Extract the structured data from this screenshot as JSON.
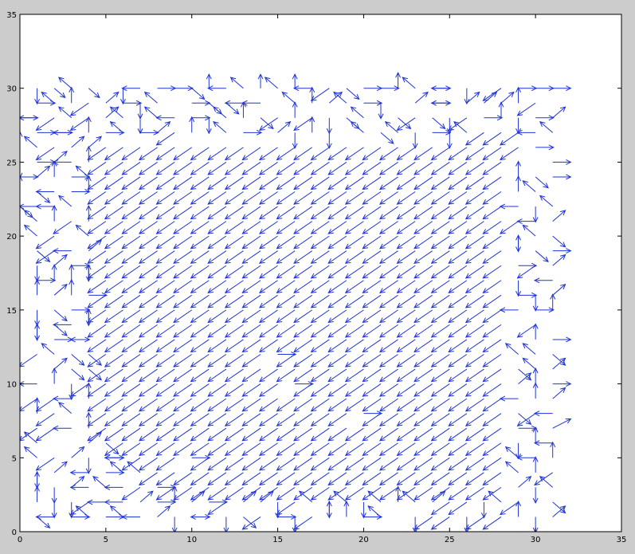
{
  "chart_data": {
    "type": "quiver",
    "title": "",
    "xlabel": "",
    "ylabel": "",
    "xlim": [
      0,
      35
    ],
    "ylim": [
      0,
      35
    ],
    "xticks": [
      0,
      5,
      10,
      15,
      20,
      25,
      30,
      35
    ],
    "yticks": [
      0,
      5,
      10,
      15,
      20,
      25,
      30,
      35
    ],
    "grid": false,
    "arrow_color": "#1f33d6",
    "axes_background": "#ffffff",
    "figure_background": "#cccccc",
    "field": {
      "x_range": [
        0,
        31
      ],
      "y_range": [
        1,
        30
      ],
      "grid_step": 1,
      "dominant_direction": "down-left (diagonal)",
      "dominant_vector": [
        -1,
        -0.8
      ]
    },
    "vectors_sample": [
      {
        "x": 1,
        "y": 28,
        "u": -1,
        "v": 0
      },
      {
        "x": 2,
        "y": 30,
        "u": 0.6,
        "v": -0.6
      },
      {
        "x": 4,
        "y": 30,
        "u": 0.6,
        "v": -0.6
      },
      {
        "x": 8,
        "y": 30,
        "u": 1,
        "v": 0
      },
      {
        "x": 9,
        "y": 30,
        "u": 1,
        "v": 0
      },
      {
        "x": 11,
        "y": 30,
        "u": 0,
        "v": 0.9
      },
      {
        "x": 14,
        "y": 30,
        "u": 0,
        "v": 0.9
      },
      {
        "x": 16,
        "y": 30,
        "u": 0,
        "v": 0.9
      },
      {
        "x": 20,
        "y": 30,
        "u": 1,
        "v": 0
      },
      {
        "x": 21,
        "y": 30,
        "u": 1,
        "v": 0
      },
      {
        "x": 29,
        "y": 30,
        "u": 1,
        "v": 0
      },
      {
        "x": 31,
        "y": 30,
        "u": 1,
        "v": 0
      },
      {
        "x": 31,
        "y": 25,
        "u": 1,
        "v": 0
      },
      {
        "x": 31,
        "y": 19,
        "u": 1,
        "v": 0
      },
      {
        "x": 31,
        "y": 13,
        "u": 1,
        "v": 0
      },
      {
        "x": 31,
        "y": 7,
        "u": 1,
        "v": 0.6
      },
      {
        "x": 30,
        "y": 1,
        "u": 0,
        "v": -1
      },
      {
        "x": 30,
        "y": 3,
        "u": 0,
        "v": -1
      },
      {
        "x": 3,
        "y": 1,
        "u": 1,
        "v": 0
      },
      {
        "x": 10,
        "y": 1,
        "u": 1,
        "v": 0
      },
      {
        "x": 15,
        "y": 1,
        "u": 1,
        "v": 0
      },
      {
        "x": 20,
        "y": 1,
        "u": 1,
        "v": 0
      },
      {
        "x": 1,
        "y": 2,
        "u": 0,
        "v": 1
      },
      {
        "x": 1,
        "y": 8,
        "u": 0,
        "v": 1
      },
      {
        "x": 1,
        "y": 14,
        "u": 0,
        "v": -1
      },
      {
        "x": 1,
        "y": 18,
        "u": 0,
        "v": -1
      },
      {
        "x": 15,
        "y": 12,
        "u": 1,
        "v": 0
      },
      {
        "x": 16,
        "y": 10,
        "u": 1,
        "v": 0
      },
      {
        "x": 20,
        "y": 8,
        "u": 1,
        "v": 0
      },
      {
        "x": 10,
        "y": 5,
        "u": 1,
        "v": 0
      }
    ]
  }
}
